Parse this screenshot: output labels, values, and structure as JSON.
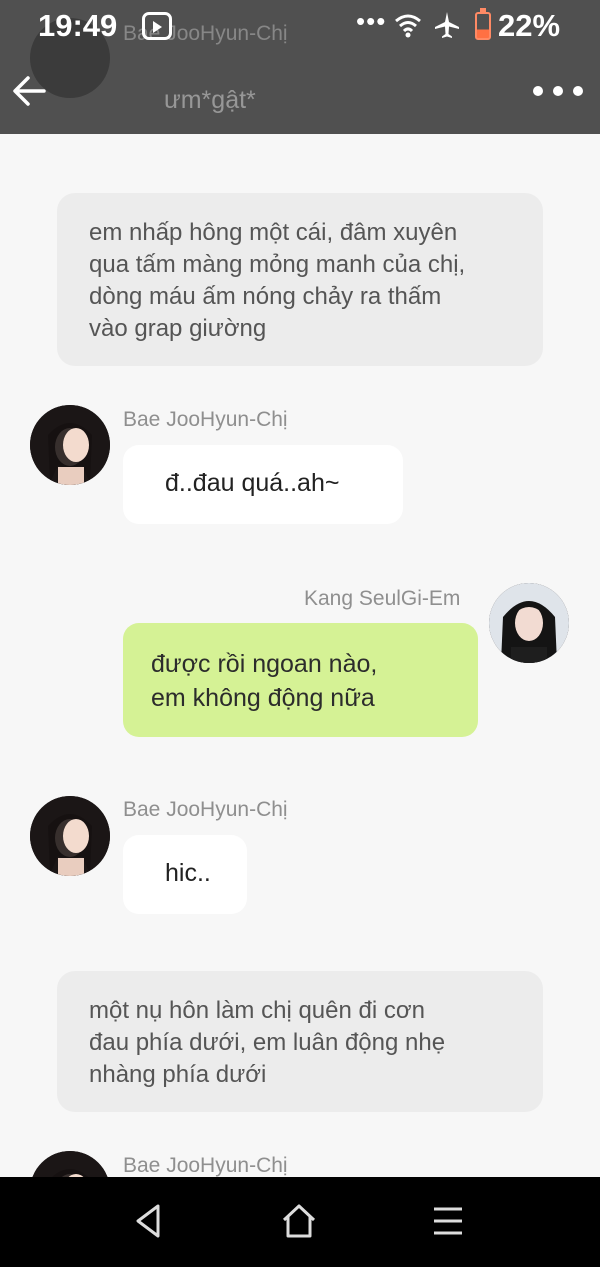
{
  "status_bar": {
    "time": "19:49",
    "battery": "22%",
    "dots": "•••",
    "icons": [
      "video-app-icon",
      "wifi-icon",
      "airplane-mode-icon",
      "battery-icon"
    ]
  },
  "header": {
    "ghost_name": "Bae JooHyun-Chị",
    "ghost_text": "ưm*gật*"
  },
  "messages": {
    "narration_1": {
      "lines": [
        "em nhấp hông một cái, đâm xuyên",
        "qua tấm màng mỏng manh của chị,",
        "dòng máu ấm nóng chảy ra thấm",
        "vào grap giường"
      ]
    },
    "msg_1": {
      "speaker": "Bae JooHyun-Chị",
      "text": "đ..đau quá..ah~"
    },
    "msg_2": {
      "speaker": "Kang SeulGi-Em",
      "lines": [
        "được rồi ngoan nào,",
        "em không động nữa"
      ]
    },
    "msg_3": {
      "speaker": "Bae JooHyun-Chị",
      "text": "hic.."
    },
    "narration_2": {
      "lines": [
        "một nụ hôn làm chị quên đi cơn",
        "đau phía dưới, em luân động nhẹ",
        "nhàng phía dưới"
      ]
    },
    "msg_4": {
      "speaker": "Bae JooHyun-Chị"
    }
  },
  "colors": {
    "background": "#f7f7f7",
    "header": "#414141",
    "narration_bg": "#ececec",
    "incoming_bubble": "#ffffff",
    "outgoing_bubble": "#d5f295",
    "speaker_name": "#8f8f8f",
    "nav_bar": "#000000"
  },
  "nav": {
    "icons": [
      "back-triangle-icon",
      "home-icon",
      "menu-icon"
    ]
  }
}
